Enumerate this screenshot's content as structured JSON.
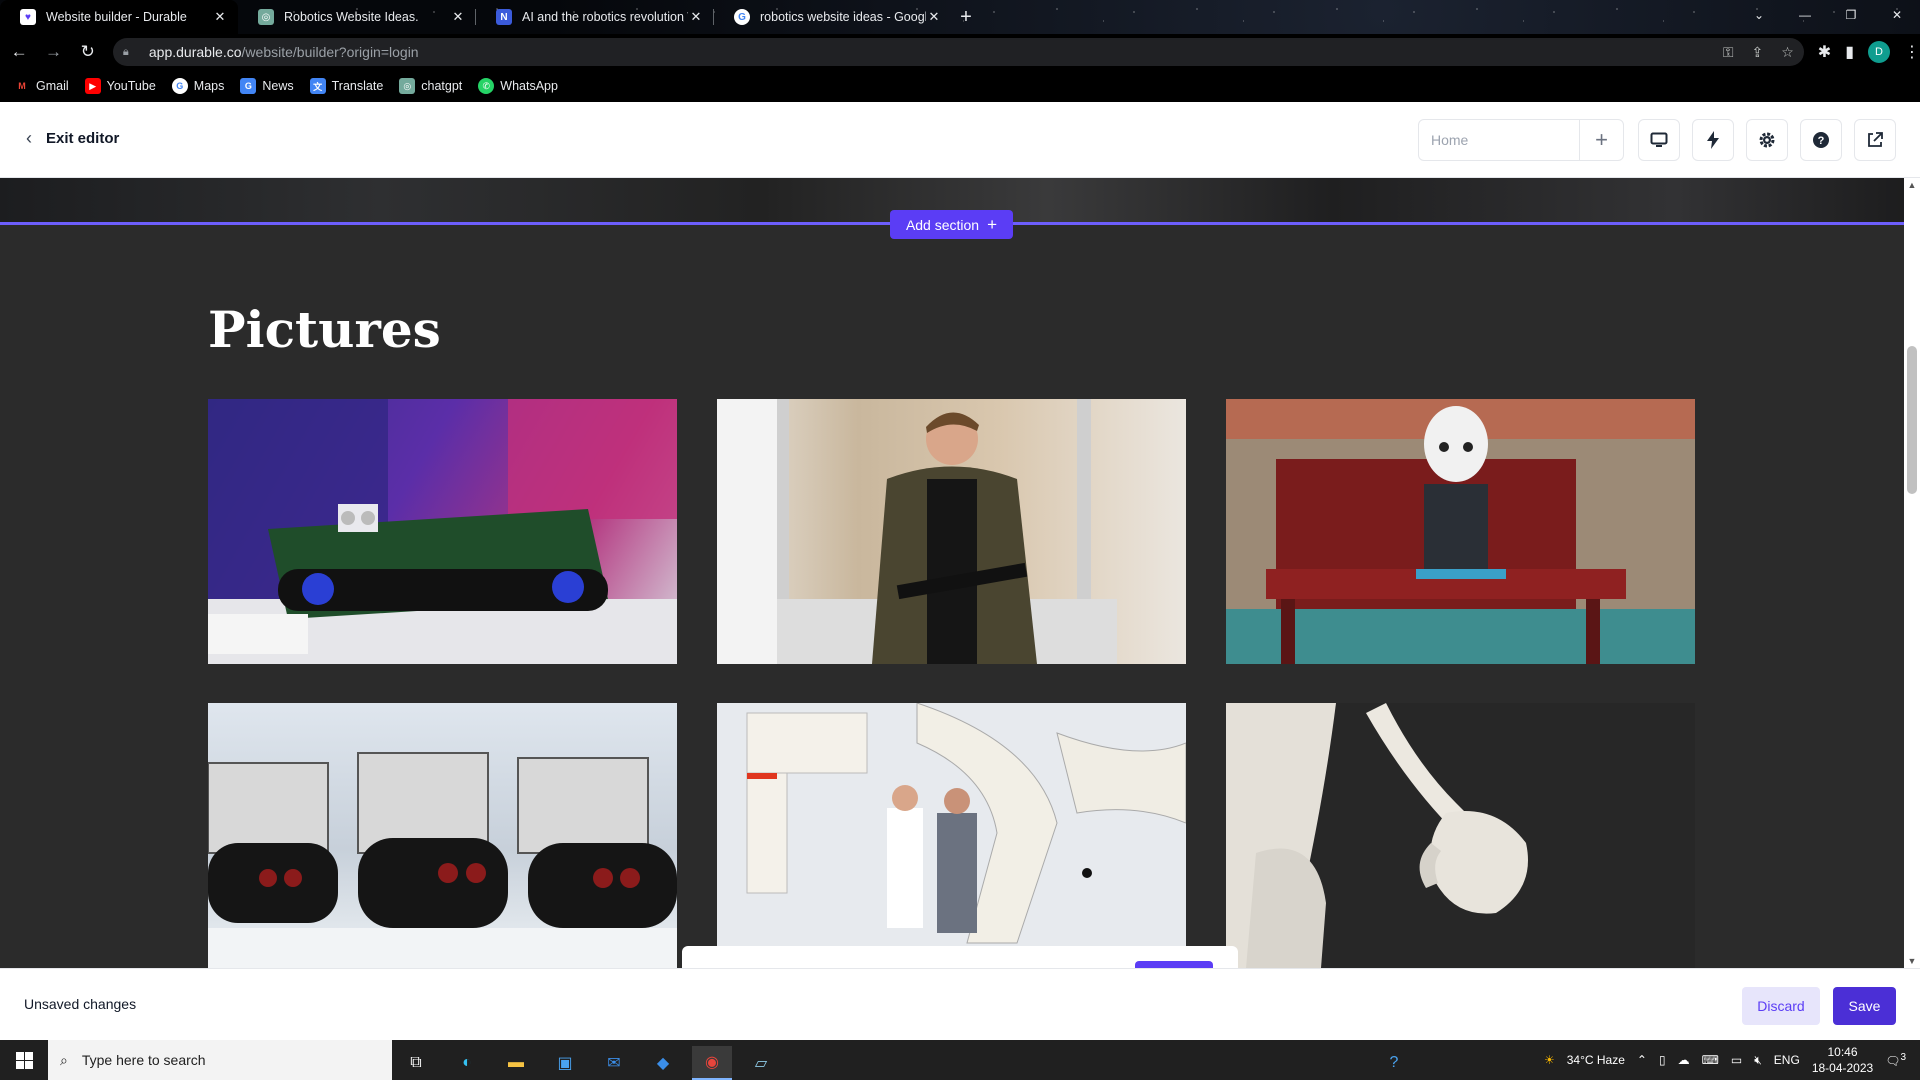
{
  "browser": {
    "tabs": [
      {
        "title": "Website builder - Durable",
        "icon": "durable-icon",
        "active": true
      },
      {
        "title": "Robotics Website Ideas.",
        "icon": "chatgpt-icon",
        "active": false
      },
      {
        "title": "AI and the robotics revolution W",
        "icon": "notion-icon",
        "active": false
      },
      {
        "title": "robotics website ideas - Google",
        "icon": "google-icon",
        "active": false
      }
    ],
    "url_host": "app.durable.co",
    "url_path": "/website/builder?origin=login",
    "profile_initial": "D",
    "bookmarks": [
      {
        "label": "Gmail",
        "icon": "gmail-icon",
        "color": "#ea4335"
      },
      {
        "label": "YouTube",
        "icon": "youtube-icon",
        "color": "#ff0000"
      },
      {
        "label": "Maps",
        "icon": "google-icon",
        "color": "#ffffff"
      },
      {
        "label": "News",
        "icon": "news-icon",
        "color": "#4285f4"
      },
      {
        "label": "Translate",
        "icon": "translate-icon",
        "color": "#4285f4"
      },
      {
        "label": "chatgpt",
        "icon": "chatgpt-icon",
        "color": "#74aa9c"
      },
      {
        "label": "WhatsApp",
        "icon": "whatsapp-icon",
        "color": "#25d366"
      }
    ]
  },
  "editor": {
    "exit_label": "Exit editor",
    "page_select_placeholder": "Home",
    "add_section_label": "Add section",
    "section_title": "Pictures",
    "accent_color": "#5b3df5",
    "gallery": [
      {
        "subject": "tracked-robot-kit"
      },
      {
        "subject": "man-with-keyboard-in-lab"
      },
      {
        "subject": "humanoid-robot-on-bench"
      },
      {
        "subject": "robot-kit-row"
      },
      {
        "subject": "kawasaki-industrial-robot-workers"
      },
      {
        "subject": "robot-hand"
      }
    ],
    "status_text": "Unsaved changes",
    "discard_label": "Discard",
    "save_label": "Save"
  },
  "taskbar": {
    "search_placeholder": "Type here to search",
    "weather": "34°C  Haze",
    "language": "ENG",
    "time": "10:46",
    "date": "18-04-2023",
    "notification_count": "3"
  }
}
